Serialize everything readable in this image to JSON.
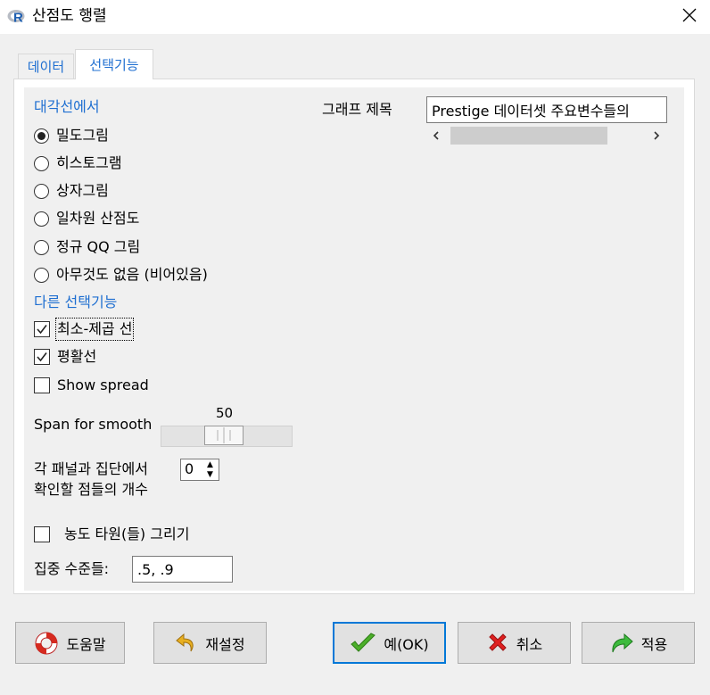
{
  "window": {
    "title": "산점도 행렬",
    "icon": "r-logo-icon",
    "close_icon": "close-icon"
  },
  "tabs": [
    {
      "label": "데이터",
      "active": false
    },
    {
      "label": "선택기능",
      "active": true
    }
  ],
  "diagonal": {
    "heading": "대각선에서",
    "options": [
      {
        "label": "밀도그림",
        "selected": true
      },
      {
        "label": "히스토그램",
        "selected": false
      },
      {
        "label": "상자그림",
        "selected": false
      },
      {
        "label": "일차원 산점도",
        "selected": false
      },
      {
        "label": "정규 QQ 그림",
        "selected": false
      },
      {
        "label": "아무것도 없음 (비어있음)",
        "selected": false
      }
    ]
  },
  "other": {
    "heading": "다른 선택기능",
    "checks": [
      {
        "label": "최소-제곱 선",
        "checked": true
      },
      {
        "label": "평활선",
        "checked": true
      },
      {
        "label": "Show spread",
        "checked": false
      }
    ]
  },
  "span": {
    "label": "Span for smooth",
    "value": "50"
  },
  "points": {
    "label_line1": "각 패널과 집단에서",
    "label_line2": "확인할 점들의 개수",
    "value": "0"
  },
  "ellipse": {
    "label": "농도 타원(들) 그리기",
    "checked": false
  },
  "levels": {
    "label": "집중 수준들:",
    "value": ".5, .9"
  },
  "graph_title": {
    "label": "그래프 제목",
    "value": "Prestige 데이터셋 주요변수들의"
  },
  "buttons": {
    "help": "도움말",
    "reset": "재설정",
    "ok": "예(OK)",
    "cancel": "취소",
    "apply": "적용"
  },
  "colors": {
    "accent": "#1f6fd1",
    "ok_border": "#0078d7"
  }
}
